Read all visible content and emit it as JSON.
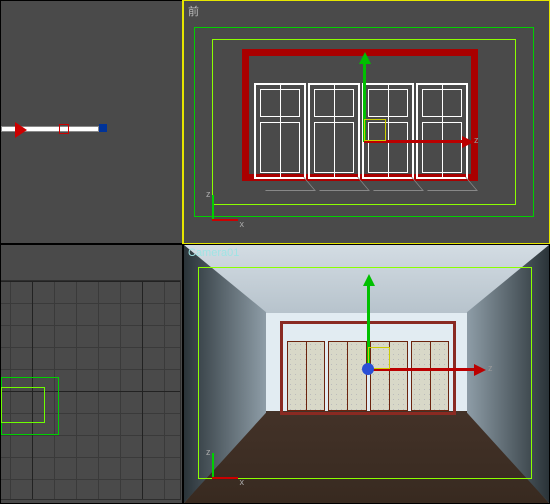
{
  "viewports": {
    "top": {
      "label": ""
    },
    "front": {
      "label": "前"
    },
    "left": {
      "label": ""
    },
    "camera": {
      "label": "Camera01"
    }
  },
  "axes": {
    "x": "x",
    "z": "z"
  },
  "gizmo": {
    "z_label": "z"
  },
  "colors": {
    "frame_red": "#a00",
    "safe_frame": "#8bff00",
    "viewport_bg": "#4a4a4a",
    "active_outline": "#e6e600"
  }
}
